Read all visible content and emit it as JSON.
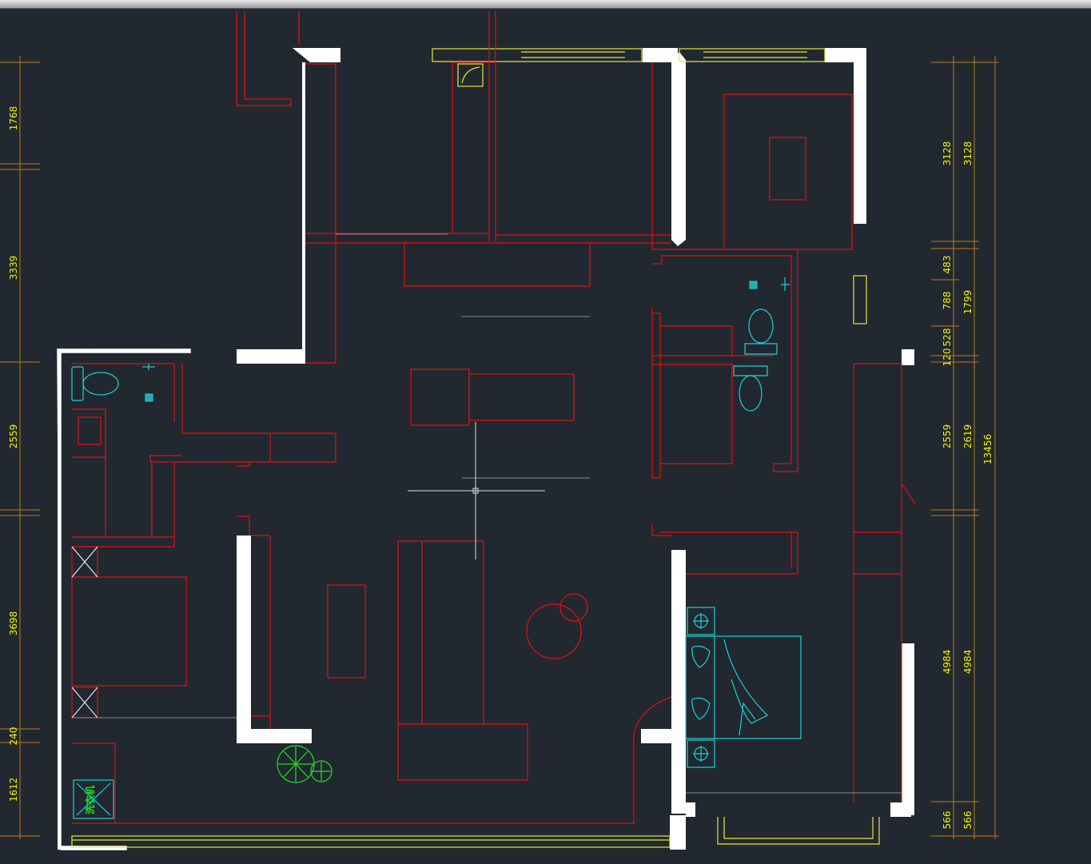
{
  "dimensions": {
    "left": [
      "1768",
      "3339",
      "2559",
      "3698",
      "240",
      "1612"
    ],
    "right_inner": [
      "3128",
      "483",
      "788",
      "528",
      "120",
      "2559",
      "4984",
      "566"
    ],
    "right_outer": [
      "3128",
      "1799",
      "2619",
      "4984",
      "566"
    ],
    "right_total": "13456"
  },
  "labels": {
    "washer": "洗衣机"
  },
  "colors": {
    "background": "#212830",
    "wall": "#ffffff",
    "furniture": "#e01010",
    "dimension_text": "#f2f200",
    "dimension_line": "#c07a1a",
    "fixtures": "#1ed0d8",
    "plants": "#22e022",
    "windows": "#e8e83a"
  }
}
